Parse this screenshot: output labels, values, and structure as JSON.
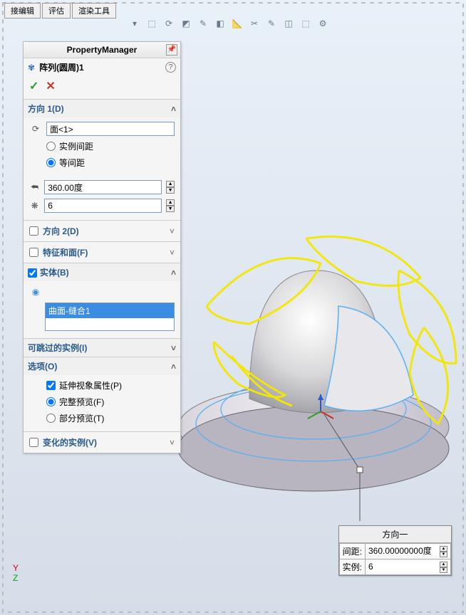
{
  "tabs": {
    "t1": "接编辑",
    "t2": "评估",
    "t3": "渲染工具"
  },
  "panel": {
    "title": "PropertyManager",
    "feature_name": "阵列(圆周)1",
    "ok_glyph": "✓",
    "cancel_glyph": "✕"
  },
  "direction1": {
    "title": "方向 1(D)",
    "face_value": "面<1>",
    "radio_instance": "实例间距",
    "radio_equal": "等间距",
    "angle_value": "360.00度",
    "count_value": "6"
  },
  "direction2": {
    "label": "方向 2(D)"
  },
  "features_faces": {
    "label": "特征和面(F)"
  },
  "bodies": {
    "title": "实体(B)",
    "selected": "曲面-缝合1"
  },
  "skip_instances": {
    "title": "可跳过的实例(I)"
  },
  "options": {
    "title": "选项(O)",
    "propagate": "延伸视象属性(P)",
    "full_preview": "完整预览(F)",
    "partial_preview": "部分预览(T)"
  },
  "vary_instances": {
    "label": "变化的实例(V)"
  },
  "callout": {
    "title": "方向一",
    "spacing_label": "间距:",
    "spacing_value": "360.00000000度",
    "instances_label": "实例:",
    "instances_value": "6"
  },
  "axis": {
    "y": "Y",
    "z": "Z"
  }
}
